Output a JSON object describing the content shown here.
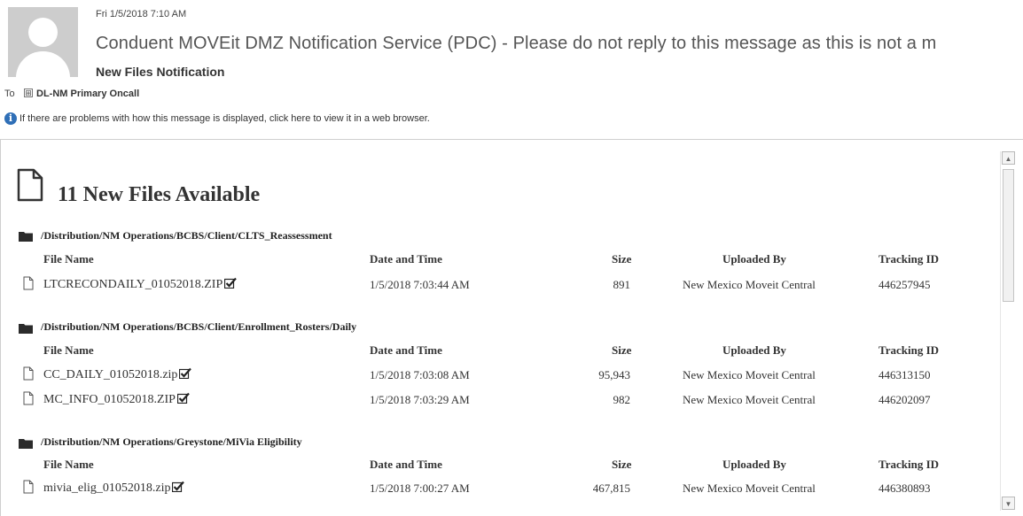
{
  "header": {
    "date": "Fri 1/5/2018 7:10 AM",
    "sender": "Conduent MOVEit DMZ Notification Service (PDC) - Please do not reply to this message as this is not a m",
    "subject": "New Files Notification",
    "to_label": "To",
    "to_expand": "⊞",
    "to_name": "DL-NM Primary Oncall",
    "info_icon": "i",
    "info_text": "If there are problems with how this message is displayed, click here to view it in a web browser."
  },
  "message": {
    "title": "11 New Files Available",
    "columns": [
      "File Name",
      "Date and Time",
      "Size",
      "Uploaded By",
      "Tracking ID"
    ],
    "groups": [
      {
        "path": "/Distribution/NM Operations/BCBS/Client/CLTS_Reassessment",
        "files": [
          {
            "name": "LTCRECONDAILY_01052018.ZIP",
            "date": "1/5/2018 7:03:44 AM",
            "size": "891",
            "uploaded_by": "New Mexico Moveit Central",
            "tracking_id": "446257945"
          }
        ]
      },
      {
        "path": "/Distribution/NM Operations/BCBS/Client/Enrollment_Rosters/Daily",
        "files": [
          {
            "name": "CC_DAILY_01052018.zip",
            "date": "1/5/2018 7:03:08 AM",
            "size": "95,943",
            "uploaded_by": "New Mexico Moveit Central",
            "tracking_id": "446313150"
          },
          {
            "name": "MC_INFO_01052018.ZIP",
            "date": "1/5/2018 7:03:29 AM",
            "size": "982",
            "uploaded_by": "New Mexico Moveit Central",
            "tracking_id": "446202097"
          }
        ]
      },
      {
        "path": "/Distribution/NM Operations/Greystone/MiVia Eligibility",
        "files": [
          {
            "name": "mivia_elig_01052018.zip",
            "date": "1/5/2018 7:00:27 AM",
            "size": "467,815",
            "uploaded_by": "New Mexico Moveit Central",
            "tracking_id": "446380893"
          }
        ]
      }
    ]
  },
  "scrollbar": {
    "up_arrow": "▲",
    "down_arrow": "▼"
  }
}
